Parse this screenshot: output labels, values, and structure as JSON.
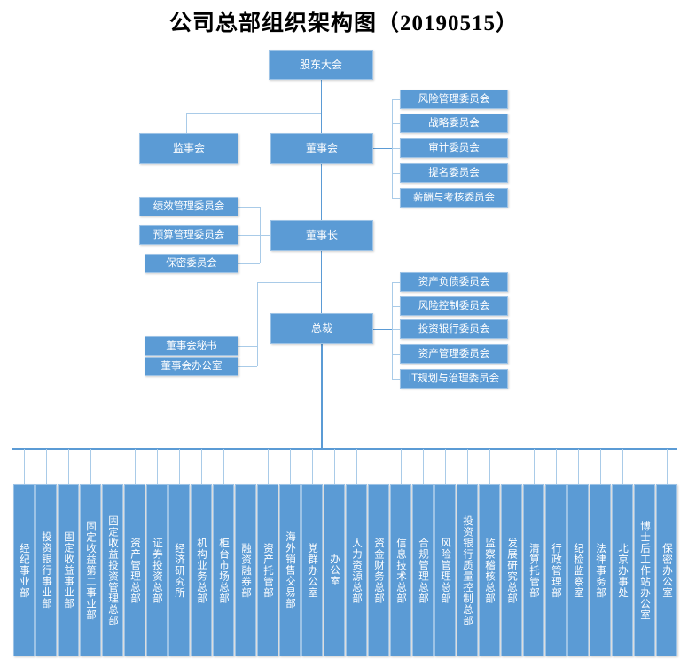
{
  "title": "公司总部组织架构图（20190515）",
  "colors": {
    "node_fill": "#5b9bd5",
    "node_border": "#9dc3e6",
    "connector": "#5b9bd5",
    "connector_light": "#a9cbe8",
    "node_text": "#ffffff",
    "title_text": "#000000",
    "background": "#ffffff"
  },
  "governance": {
    "shareholders_meeting": "股东大会",
    "supervisory_board": "监事会",
    "board_of_directors": "董事会",
    "chairman": "董事长",
    "president": "总裁"
  },
  "board_committees": [
    "风险管理委员会",
    "战略委员会",
    "审计委员会",
    "提名委员会",
    "薪酬与考核委员会"
  ],
  "chairman_committees": [
    "绩效管理委员会",
    "预算管理委员会",
    "保密委员会"
  ],
  "board_offices": [
    "董事会秘书",
    "董事会办公室"
  ],
  "president_committees": [
    "资产负债委员会",
    "风险控制委员会",
    "投资银行委员会",
    "资产管理委员会",
    "IT规划与治理委员会"
  ],
  "departments": [
    "经纪事业部",
    "投资银行事业部",
    "固定收益事业部",
    "固定收益第二事业部",
    "固定收益投资管理总部",
    "资产管理总部",
    "证券投资总部",
    "经济研究所",
    "机构业务总部",
    "柜台市场总部",
    "融资融券部",
    "资产托管部",
    "海外销售交易部",
    "党群办公室",
    "办公室",
    "人力资源总部",
    "资金财务总部",
    "信息技术总部",
    "合规管理总部",
    "风险管理总部",
    "投资银行质量控制总部",
    "监察稽核总部",
    "发展研究总部",
    "清算托管部",
    "行政管理部",
    "纪检监察室",
    "法律事务部",
    "北京办事处",
    "博士后工作站办公室",
    "保密办公室"
  ]
}
